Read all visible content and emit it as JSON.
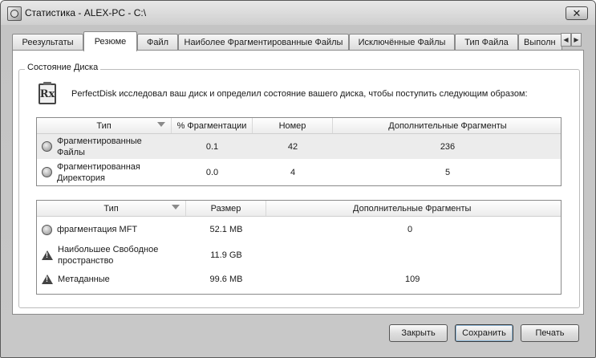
{
  "window": {
    "title": "Статистика - ALEX-PC - C:\\",
    "close_glyph": "✕"
  },
  "tabs": [
    {
      "label": "Реезультаты",
      "active": false
    },
    {
      "label": "Резюме",
      "active": true
    },
    {
      "label": "Файл",
      "active": false
    },
    {
      "label": "Наиболее Фрагментированные Файлы",
      "active": false
    },
    {
      "label": "Исключённые Файлы",
      "active": false
    },
    {
      "label": "Тип Файла",
      "active": false
    },
    {
      "label": "Выполн",
      "active": false
    }
  ],
  "tab_scroll": {
    "left": "◀",
    "right": "▶"
  },
  "group": {
    "label": "Состояние Диска",
    "icon": "rx-prescription-icon",
    "icon_glyph": "Rx",
    "message": "PerfectDisk исследовал ваш диск и определил состояние вашего диска, чтобы поступить следующим образом:"
  },
  "table1": {
    "headers": [
      "Тип",
      "% Фрагментации",
      "Номер",
      "Дополнительные Фрагменты"
    ],
    "rows": [
      {
        "icon": "status-circle-icon",
        "type": "Фрагментированные Файлы",
        "frag": "0.1",
        "number": "42",
        "extra": "236",
        "selected": true
      },
      {
        "icon": "status-circle-icon",
        "type": "Фрагментированная Директория",
        "frag": "0.0",
        "number": "4",
        "extra": "5",
        "selected": false
      }
    ]
  },
  "table2": {
    "headers": [
      "Тип",
      "Размер",
      "Дополнительные Фрагменты"
    ],
    "rows": [
      {
        "icon": "status-circle-icon",
        "type": "фрагментация MFT",
        "size": "52.1 MB",
        "extra": "0"
      },
      {
        "icon": "warning-icon",
        "type": "Наибольшее Свободное пространство",
        "size": "11.9 GB",
        "extra": ""
      },
      {
        "icon": "warning-icon",
        "type": "Метаданные",
        "size": "99.6 MB",
        "extra": "109"
      }
    ]
  },
  "buttons": {
    "close": {
      "label": "Закрыть",
      "mnemonic": "З"
    },
    "save": {
      "label": "Сохранить",
      "mnemonic": "С"
    },
    "print": {
      "label": "Печать",
      "mnemonic": "П"
    }
  }
}
